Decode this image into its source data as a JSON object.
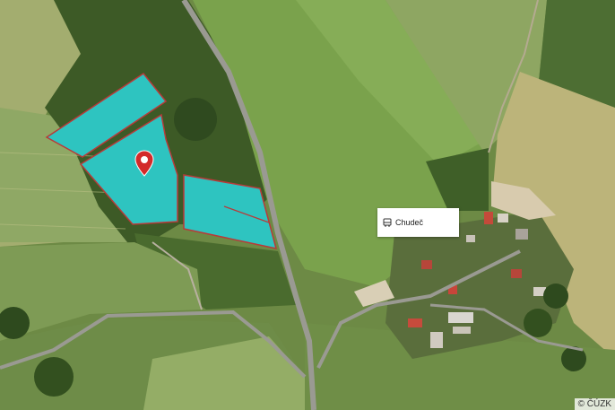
{
  "map": {
    "type": "aerial-orthophoto",
    "parcel_fill_color": "#2ec4c0",
    "parcel_outline_color": "#b83a3a",
    "marker_color": "#d32a2a",
    "marker_icon": "location-pin-icon"
  },
  "poi": {
    "label": "Chudeč",
    "icon": "bus-stop-icon"
  },
  "attribution": "© ČÚZK"
}
